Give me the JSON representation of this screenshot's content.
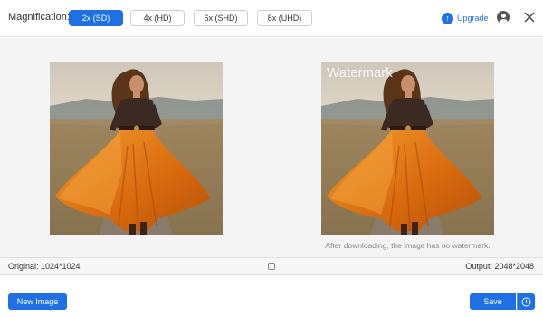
{
  "toolbar": {
    "magnification_label": "Magnification:",
    "options": [
      "2x (SD)",
      "4x (HD)",
      "6x (SHD)",
      "8x (UHD)"
    ],
    "selected_option": "2x (SD)",
    "upgrade_label": "Upgrade"
  },
  "preview": {
    "watermark_text": "Watermark",
    "note": "After downloading, the image has no watermark."
  },
  "status": {
    "original": "Original: 1024*1024",
    "output": "Output: 2048*2048"
  },
  "footer": {
    "new_image_label": "New Image",
    "save_label": "Save"
  },
  "colors": {
    "accent": "#1f6fe5",
    "dress": "#e07a12"
  },
  "icons": [
    "upgrade-arrow-icon",
    "user-icon",
    "close-icon",
    "compare-icon",
    "clock-icon"
  ]
}
